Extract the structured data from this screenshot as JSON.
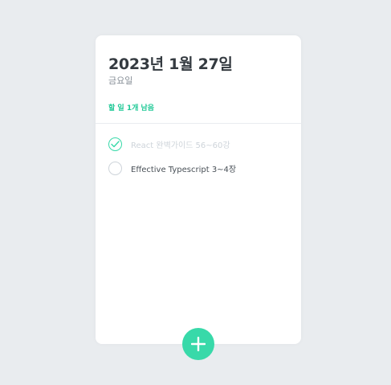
{
  "header": {
    "date": "2023년 1월 27일",
    "day": "금요일",
    "tasks_left": "할 일 1개 남음"
  },
  "todos": [
    {
      "text": "React 완벽가이드 56~60강",
      "done": true,
      "icon": "check-icon"
    },
    {
      "text": "Effective Typescript 3~4장",
      "done": false,
      "icon": "empty-circle"
    }
  ],
  "add_button": {
    "icon": "plus-icon"
  },
  "colors": {
    "accent": "#38d9a9",
    "accent_text": "#20c997",
    "done_text": "#ced4da",
    "background": "#e9ecef"
  }
}
